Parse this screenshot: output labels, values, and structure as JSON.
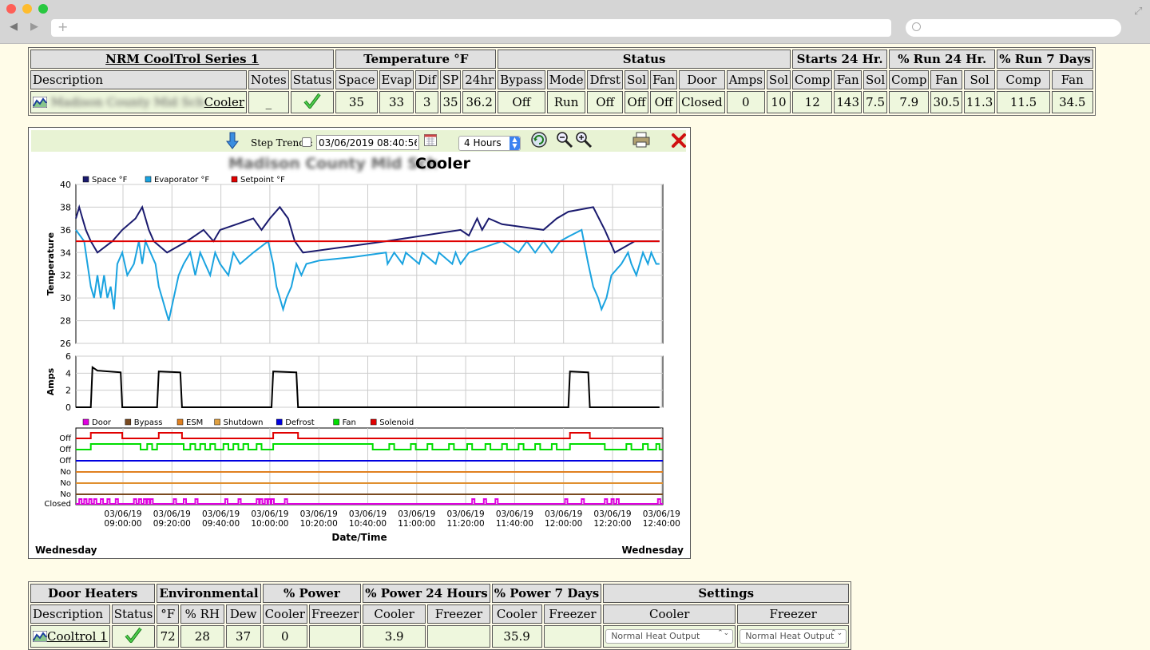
{
  "cooltrol": {
    "title": "NRM CoolTrol Series 1",
    "groups": {
      "temperature": "Temperature °F",
      "status": "Status",
      "starts": "Starts 24 Hr.",
      "run24": "% Run 24 Hr.",
      "run7": "% Run 7 Days"
    },
    "headers": {
      "description": "Description",
      "notes": "Notes",
      "status": "Status",
      "space": "Space",
      "evap": "Evap",
      "dif": "Dif",
      "sp": "SP",
      "h24": "24hr",
      "bypass": "Bypass",
      "mode": "Mode",
      "dfrst": "Dfrst",
      "sol": "Sol",
      "fan": "Fan",
      "door": "Door",
      "amps": "Amps",
      "comp": "Comp"
    },
    "row": {
      "location": "Madison County Mid Sch",
      "unit": "Cooler",
      "notes": "_",
      "space": "35",
      "evap": "33",
      "dif": "3",
      "sp": "35",
      "h24": "36.2",
      "bypass": "Off",
      "mode": "Run",
      "dfrst": "Off",
      "sol": "Off",
      "fan": "Off",
      "door": "Closed",
      "amps": "0",
      "starts_sol": "10",
      "starts_comp": "12",
      "starts_fan": "143",
      "run24_sol": "7.5",
      "run24_comp": "7.9",
      "run24_fan": "30.5",
      "run7_sol": "11.3",
      "run7_comp": "11.5",
      "run7_fan": "34.5"
    }
  },
  "toolbar": {
    "step_trends_label": "Step Trends:",
    "datetime": "03/06/2019 08:40:56",
    "range": "4 Hours"
  },
  "chart_data": {
    "type": "line",
    "title_location": "Madison County Mid Sch",
    "title_unit": "Cooler",
    "x_ticks": [
      {
        "d": "03/06/19",
        "t": "09:00:00"
      },
      {
        "d": "03/06/19",
        "t": "09:20:00"
      },
      {
        "d": "03/06/19",
        "t": "09:40:00"
      },
      {
        "d": "03/06/19",
        "t": "10:00:00"
      },
      {
        "d": "03/06/19",
        "t": "10:20:00"
      },
      {
        "d": "03/06/19",
        "t": "10:40:00"
      },
      {
        "d": "03/06/19",
        "t": "11:00:00"
      },
      {
        "d": "03/06/19",
        "t": "11:20:00"
      },
      {
        "d": "03/06/19",
        "t": "11:40:00"
      },
      {
        "d": "03/06/19",
        "t": "12:00:00"
      },
      {
        "d": "03/06/19",
        "t": "12:20:00"
      },
      {
        "d": "03/06/19",
        "t": "12:40:00"
      }
    ],
    "xlabel": "Date/Time",
    "day_left": "Wednesday",
    "day_right": "Wednesday",
    "temperature": {
      "ylabel": "Temperature",
      "ylim": [
        26,
        40
      ],
      "yticks": [
        26,
        28,
        30,
        32,
        34,
        36,
        38,
        40
      ],
      "series": [
        {
          "name": "Space °F",
          "color": "#1a1a6e",
          "points": [
            [
              8.6,
              37
            ],
            [
              9,
              38
            ],
            [
              9.4,
              37
            ],
            [
              9.8,
              36
            ],
            [
              10.4,
              35
            ],
            [
              11.2,
              34
            ],
            [
              13,
              35
            ],
            [
              14.2,
              36
            ],
            [
              15.8,
              37
            ],
            [
              16.6,
              38
            ],
            [
              17.4,
              36
            ],
            [
              18,
              35
            ],
            [
              19.6,
              34
            ],
            [
              22,
              35
            ],
            [
              24,
              36
            ],
            [
              25.2,
              35
            ],
            [
              26,
              36
            ],
            [
              28,
              36.5
            ],
            [
              30,
              37
            ],
            [
              31,
              36
            ],
            [
              32,
              37
            ],
            [
              33.2,
              38
            ],
            [
              34.2,
              37
            ],
            [
              35,
              35
            ],
            [
              36,
              34
            ],
            [
              46,
              35
            ],
            [
              55,
              36
            ],
            [
              56,
              35.5
            ],
            [
              57,
              37
            ],
            [
              57.6,
              36
            ],
            [
              58.4,
              37
            ],
            [
              60,
              36.5
            ],
            [
              65,
              36
            ],
            [
              66.6,
              37
            ],
            [
              68,
              37.6
            ],
            [
              71,
              38
            ],
            [
              72.4,
              36
            ],
            [
              73.6,
              34
            ],
            [
              76,
              35
            ],
            [
              79,
              35
            ]
          ]
        },
        {
          "name": "Evaporator °F",
          "color": "#1aa3e0",
          "points": [
            [
              8.6,
              36
            ],
            [
              9.6,
              35
            ],
            [
              10,
              33
            ],
            [
              10.4,
              31
            ],
            [
              10.8,
              30
            ],
            [
              11.2,
              32
            ],
            [
              11.6,
              30
            ],
            [
              12,
              32
            ],
            [
              12.4,
              30
            ],
            [
              12.8,
              31
            ],
            [
              13.2,
              29
            ],
            [
              13.6,
              33
            ],
            [
              14.2,
              34
            ],
            [
              14.8,
              32
            ],
            [
              15.6,
              33
            ],
            [
              16.2,
              35
            ],
            [
              16.6,
              33
            ],
            [
              17,
              35
            ],
            [
              17.6,
              34
            ],
            [
              18.2,
              33
            ],
            [
              18.6,
              31
            ],
            [
              19,
              30
            ],
            [
              19.4,
              29
            ],
            [
              19.8,
              28
            ],
            [
              20.4,
              30
            ],
            [
              21,
              32
            ],
            [
              21.6,
              33
            ],
            [
              22.4,
              34
            ],
            [
              23,
              32
            ],
            [
              23.6,
              34
            ],
            [
              24.2,
              33
            ],
            [
              24.8,
              32
            ],
            [
              25.4,
              34
            ],
            [
              26,
              33
            ],
            [
              27,
              32
            ],
            [
              27.6,
              34
            ],
            [
              28.4,
              33
            ],
            [
              30,
              34
            ],
            [
              31.8,
              35
            ],
            [
              32.4,
              33
            ],
            [
              32.8,
              31
            ],
            [
              33.2,
              30
            ],
            [
              33.6,
              29
            ],
            [
              34,
              30
            ],
            [
              34.6,
              31
            ],
            [
              35.2,
              33
            ],
            [
              35.8,
              32
            ],
            [
              36.4,
              33
            ],
            [
              38,
              33.3
            ],
            [
              42,
              33.6
            ],
            [
              46,
              34
            ],
            [
              46.2,
              33
            ],
            [
              47,
              34
            ],
            [
              48,
              33
            ],
            [
              48.4,
              34
            ],
            [
              50,
              33
            ],
            [
              50.4,
              34
            ],
            [
              52,
              33
            ],
            [
              52.4,
              34
            ],
            [
              54,
              33
            ],
            [
              54.4,
              34
            ],
            [
              55,
              33
            ],
            [
              56,
              34
            ],
            [
              60,
              35
            ],
            [
              62,
              34
            ],
            [
              63,
              35
            ],
            [
              64,
              34
            ],
            [
              65,
              35
            ],
            [
              66,
              34
            ],
            [
              67,
              35
            ],
            [
              68,
              35.4
            ],
            [
              69.6,
              36
            ],
            [
              70.4,
              33
            ],
            [
              71,
              31
            ],
            [
              71.6,
              30
            ],
            [
              72,
              29
            ],
            [
              72.6,
              30
            ],
            [
              73.2,
              32
            ],
            [
              74.4,
              33
            ],
            [
              75.2,
              34
            ],
            [
              75.6,
              33
            ],
            [
              76.2,
              32
            ],
            [
              77,
              34
            ],
            [
              77.6,
              33
            ],
            [
              78,
              34
            ],
            [
              78.6,
              33
            ],
            [
              79,
              33
            ]
          ]
        },
        {
          "name": "Setpoint °F",
          "color": "#e00000",
          "points": [
            [
              8.6,
              35
            ],
            [
              79,
              35
            ]
          ]
        }
      ]
    },
    "amps": {
      "ylabel": "Amps",
      "ylim": [
        0,
        6
      ],
      "yticks": [
        0,
        2,
        4,
        6
      ],
      "series": [
        {
          "name": "Amps",
          "color": "#000000",
          "points": [
            [
              8.6,
              0
            ],
            [
              10.4,
              0
            ],
            [
              10.6,
              4.7
            ],
            [
              11.2,
              4.3
            ],
            [
              14,
              4.1
            ],
            [
              14.2,
              0
            ],
            [
              18.4,
              0
            ],
            [
              18.6,
              4.2
            ],
            [
              21.2,
              4.1
            ],
            [
              21.4,
              0
            ],
            [
              32.2,
              0
            ],
            [
              32.4,
              4.2
            ],
            [
              35.2,
              4.1
            ],
            [
              35.4,
              0
            ],
            [
              68,
              0
            ],
            [
              68.2,
              4.2
            ],
            [
              70.4,
              4.1
            ],
            [
              70.6,
              0
            ],
            [
              79,
              0
            ]
          ]
        }
      ]
    },
    "status": {
      "legend": [
        {
          "name": "Door",
          "color": "#e000e0"
        },
        {
          "name": "Bypass",
          "color": "#7a4a20"
        },
        {
          "name": "ESM",
          "color": "#e08020"
        },
        {
          "name": "Shutdown",
          "color": "#e0a040"
        },
        {
          "name": "Defrost",
          "color": "#0000e0"
        },
        {
          "name": "Fan",
          "color": "#00dd00"
        },
        {
          "name": "Solenoid",
          "color": "#e00000"
        }
      ],
      "row_labels": [
        "Off",
        "Off",
        "Off",
        "No",
        "No",
        "No",
        "Closed"
      ],
      "solenoid_on": [
        [
          10.4,
          14.2
        ],
        [
          18.6,
          21.4
        ],
        [
          32.4,
          35.4
        ],
        [
          68.2,
          70.6
        ]
      ],
      "fan_on": [
        [
          10.4,
          16.4
        ],
        [
          17.2,
          17.8
        ],
        [
          18.4,
          21.6
        ],
        [
          22.4,
          23
        ],
        [
          23.6,
          24.2
        ],
        [
          24.8,
          25.4
        ],
        [
          26.4,
          27
        ],
        [
          27.6,
          28.2
        ],
        [
          28.8,
          29.4
        ],
        [
          30.4,
          31
        ],
        [
          32.4,
          44.4
        ],
        [
          46.4,
          47
        ],
        [
          49,
          49.6
        ],
        [
          51,
          51.6
        ],
        [
          53.6,
          54.2
        ],
        [
          55.8,
          56.4
        ],
        [
          58,
          58.6
        ],
        [
          60,
          60.6
        ],
        [
          62,
          62.6
        ],
        [
          64,
          64.6
        ],
        [
          66,
          66.6
        ],
        [
          68.2,
          72.4
        ],
        [
          75,
          75.6
        ],
        [
          77,
          77.6
        ],
        [
          78.6,
          79
        ]
      ],
      "door_open": [
        9,
        9.6,
        10.2,
        10.8,
        11.6,
        12.4,
        13.4,
        15.6,
        16.2,
        16.8,
        17.2,
        17.6,
        20.4,
        21.6,
        23,
        26.6,
        28.2,
        30.4,
        30.8,
        31.4,
        31.8,
        32.2,
        33.8,
        56.4,
        57.8,
        59.2,
        67.6,
        69.6,
        72.4,
        73.2,
        73.8,
        78.8
      ]
    }
  },
  "door_heaters": {
    "groups": {
      "door_heaters": "Door Heaters",
      "environmental": "Environmental",
      "power": "% Power",
      "power24": "% Power 24 Hours",
      "power7": "% Power 7 Days",
      "settings": "Settings"
    },
    "headers": {
      "description": "Description",
      "status": "Status",
      "f": "°F",
      "rh": "% RH",
      "dew": "Dew",
      "cooler": "Cooler",
      "freezer": "Freezer"
    },
    "row": {
      "name": "Cooltrol 1",
      "f": "72",
      "rh": "28",
      "dew": "37",
      "power_cooler": "0",
      "power_freezer": "",
      "p24_cooler": "3.9",
      "p24_freezer": "",
      "p7_cooler": "35.9",
      "p7_freezer": "",
      "setting_cooler": "Normal Heat Output",
      "setting_freezer": "Normal Heat Output"
    }
  }
}
